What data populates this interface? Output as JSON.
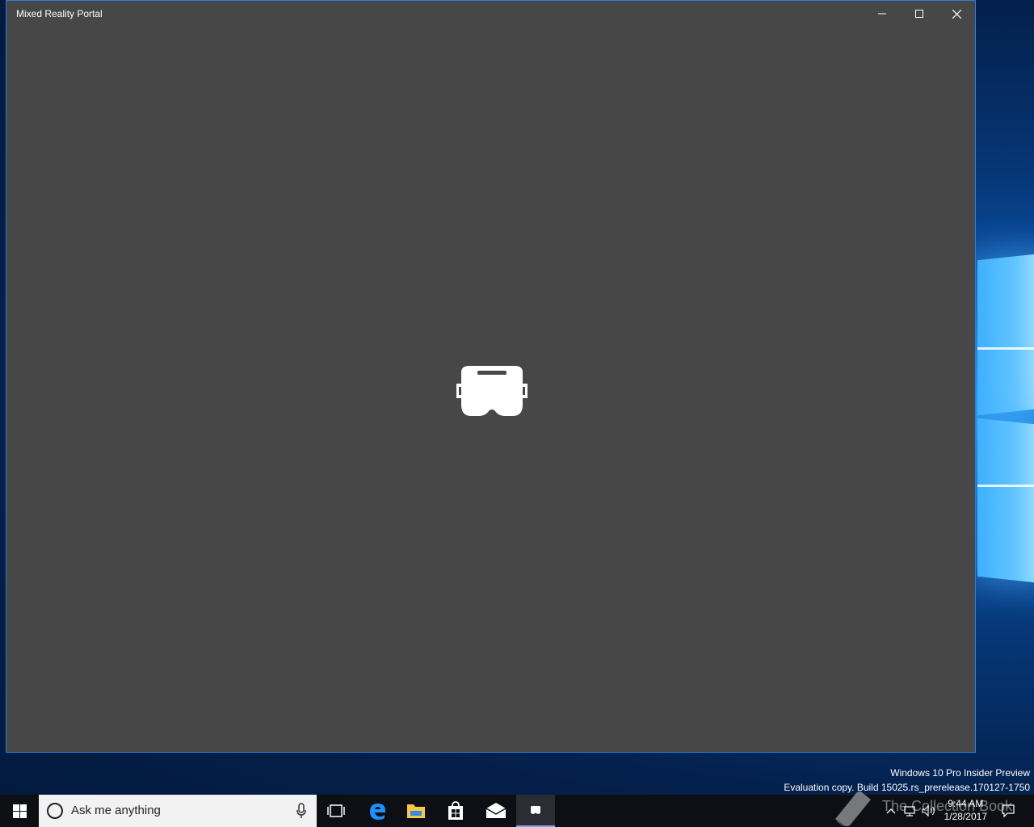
{
  "window": {
    "title": "Mixed Reality Portal",
    "minimize_icon": "minimize-icon",
    "maximize_icon": "maximize-icon",
    "close_icon": "close-icon",
    "center_icon": "vr-headset-icon",
    "background_color": "#474747",
    "accent_color": "#2c7fd6"
  },
  "watermark": {
    "line1": "Windows 10 Pro Insider Preview",
    "line2": "Evaluation copy. Build 15025.rs_prerelease.170127-1750",
    "overlay_text": "The Collection Book"
  },
  "taskbar": {
    "search_placeholder": "Ask me anything",
    "apps": [
      "task-view-icon",
      "edge-icon",
      "file-explorer-icon",
      "store-icon",
      "mail-icon",
      "mixed-reality-portal-icon"
    ],
    "clock_time": "9:44 AM",
    "clock_date": "1/28/2017"
  }
}
